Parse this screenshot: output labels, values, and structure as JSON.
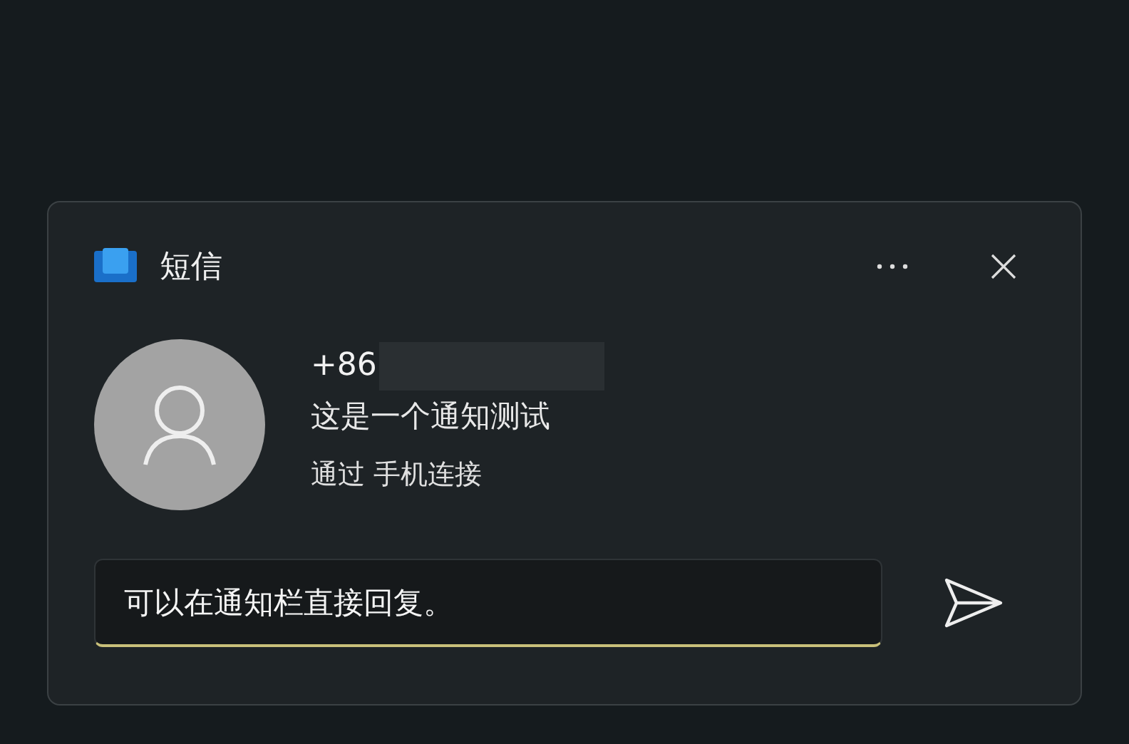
{
  "app": {
    "name": "短信"
  },
  "message": {
    "sender": "+86",
    "body": "这是一个通知测试",
    "via": "通过 手机连接"
  },
  "reply": {
    "value": "可以在通知栏直接回复。"
  }
}
